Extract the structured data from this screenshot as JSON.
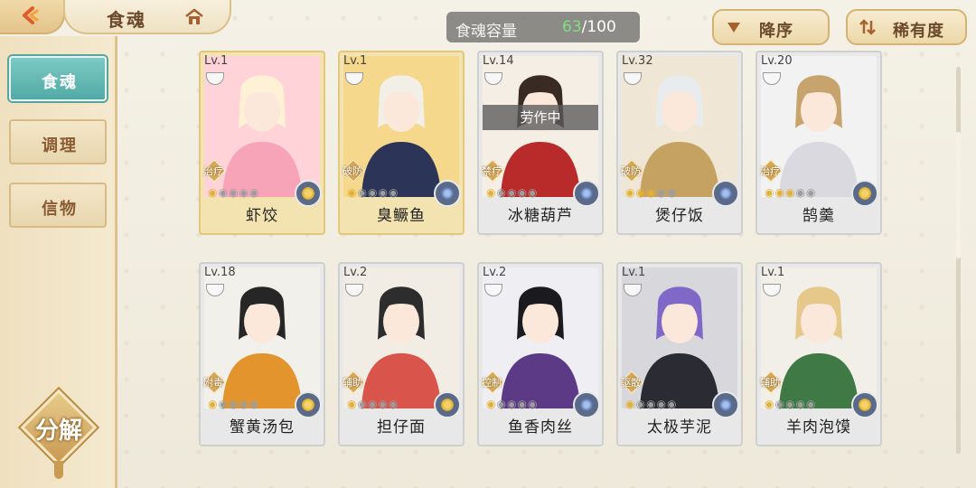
{
  "header": {
    "title": "食魂",
    "capacity_label": "食魂容量",
    "capacity_current": "63",
    "capacity_total": "/100",
    "sort_order_label": "降序",
    "sort_rarity_label": "稀有度"
  },
  "sidebar": {
    "tabs": [
      {
        "label": "食魂",
        "active": true
      },
      {
        "label": "调理",
        "active": false
      },
      {
        "label": "信物",
        "active": false
      }
    ],
    "decompose_label": "分解"
  },
  "cards": [
    {
      "level": "Lv.1",
      "role": "治疗",
      "name": "虾饺",
      "stars": 1,
      "element": "gold",
      "status": "",
      "frame": "gold",
      "portrait_colors": [
        "#ffd3d8",
        "#f7a3b8",
        "#fff1d6"
      ]
    },
    {
      "level": "Lv.1",
      "role": "破防",
      "name": "臭鳜鱼",
      "stars": 1,
      "element": "blue",
      "status": "",
      "frame": "gold",
      "portrait_colors": [
        "#f6d88d",
        "#2c3557",
        "#f2efe7"
      ]
    },
    {
      "level": "Lv.14",
      "role": "禁疗",
      "name": "冰糖葫芦",
      "stars": 1,
      "element": "blue",
      "status": "劳作中",
      "frame": "silver",
      "portrait_colors": [
        "#f4eee4",
        "#b92b2b",
        "#3a2a24"
      ]
    },
    {
      "level": "Lv.32",
      "role": "破防",
      "name": "煲仔饭",
      "stars": 3,
      "element": "blue",
      "status": "",
      "frame": "silver",
      "portrait_colors": [
        "#efe6d6",
        "#c6a262",
        "#e9ecee"
      ]
    },
    {
      "level": "Lv.20",
      "role": "治疗",
      "name": "鹄羹",
      "stars": 3,
      "element": "gold",
      "status": "",
      "frame": "silver",
      "portrait_colors": [
        "#f2f2f2",
        "#d9d9df",
        "#c7a46d"
      ]
    },
    {
      "level": "Lv.18",
      "role": "附毒",
      "name": "蟹黄汤包",
      "stars": 1,
      "element": "gold",
      "status": "",
      "frame": "silver",
      "portrait_colors": [
        "#f2f0ea",
        "#e4942c",
        "#262626"
      ]
    },
    {
      "level": "Lv.2",
      "role": "辅助",
      "name": "担仔面",
      "stars": 1,
      "element": "gold",
      "status": "",
      "frame": "silver",
      "portrait_colors": [
        "#f1ece4",
        "#d9544b",
        "#2d2d2d"
      ]
    },
    {
      "level": "Lv.2",
      "role": "控制",
      "name": "鱼香肉丝",
      "stars": 1,
      "element": "blue",
      "status": "",
      "frame": "silver",
      "portrait_colors": [
        "#efeef2",
        "#5c3a86",
        "#1b1b1f"
      ]
    },
    {
      "level": "Lv.1",
      "role": "驱散",
      "name": "太极芋泥",
      "stars": 1,
      "element": "blue",
      "status": "",
      "frame": "silver",
      "portrait_colors": [
        "#d8d8dc",
        "#2b2b33",
        "#8068c8"
      ]
    },
    {
      "level": "Lv.1",
      "role": "辅助",
      "name": "羊肉泡馍",
      "stars": 1,
      "element": "gold",
      "status": "",
      "frame": "silver",
      "portrait_colors": [
        "#f1efe8",
        "#3f7a46",
        "#e7c88b"
      ]
    }
  ],
  "icons": {
    "back": "back-arrow-icon",
    "home": "home-icon",
    "sort": "sort-arrow-icon",
    "rarity": "rarity-sort-icon",
    "bowl": "bowl-icon",
    "element": "element-flower-icon"
  }
}
